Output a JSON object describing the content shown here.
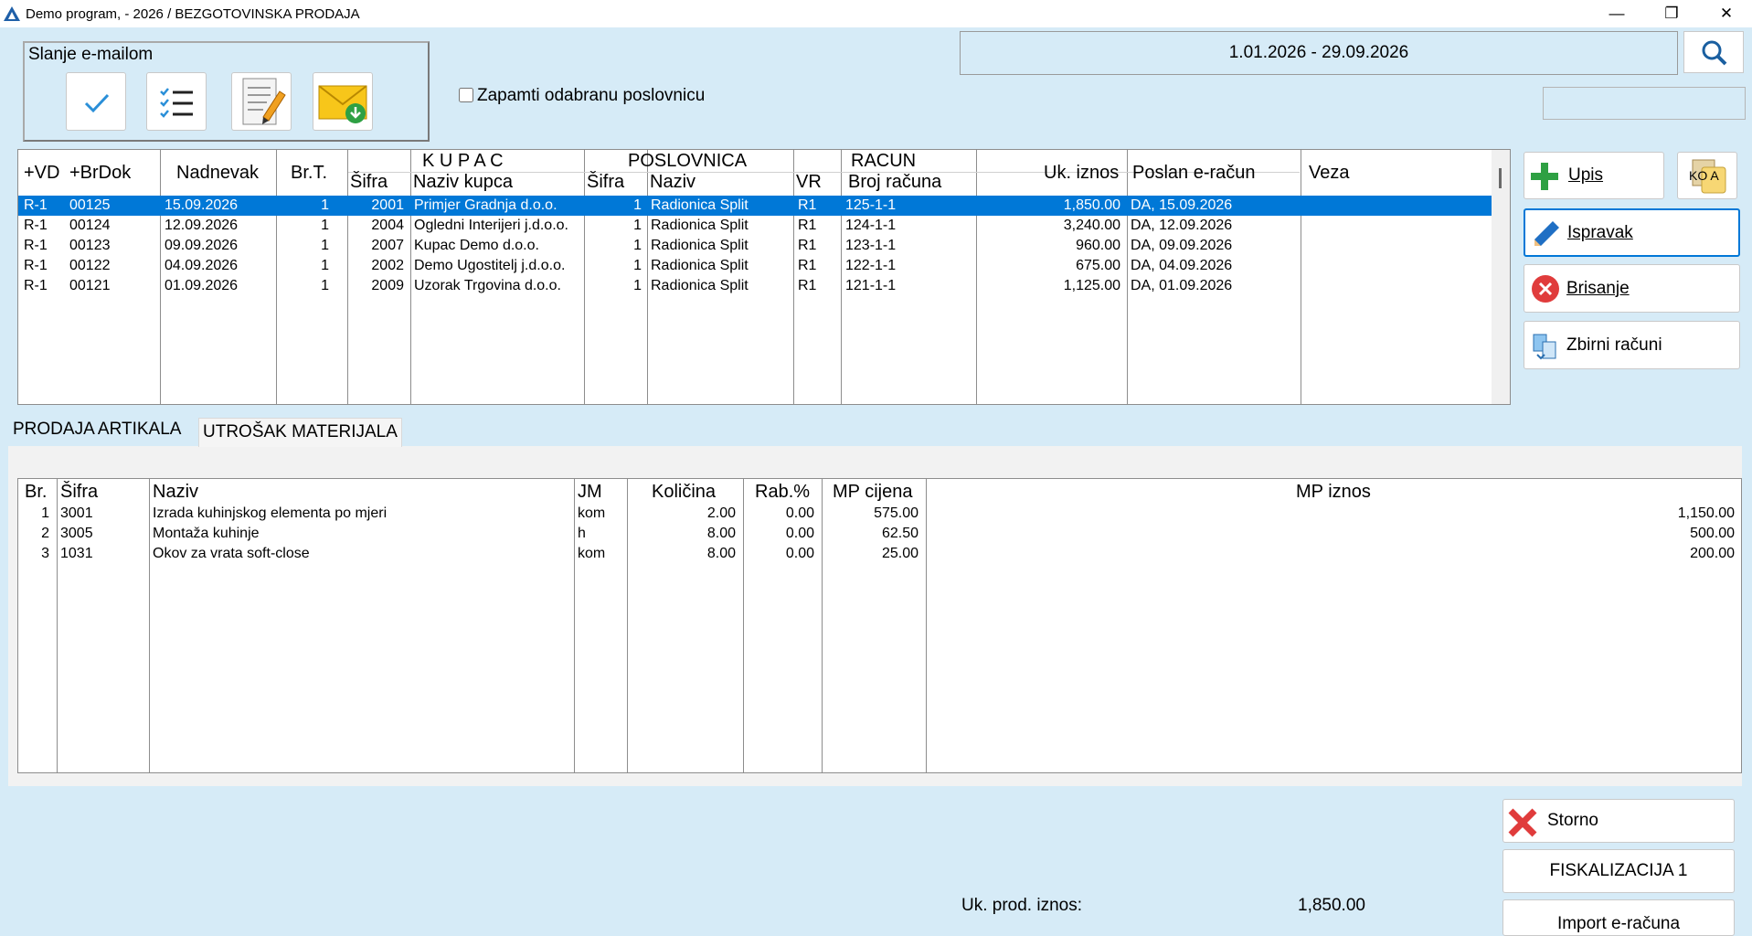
{
  "window": {
    "title": "Demo program, - 2026 / BEZGOTOVINSKA PRODAJA",
    "min_glyph": "—",
    "restore_glyph": "❐",
    "close_glyph": "✕"
  },
  "email_group": {
    "caption": "Slanje e-mailom",
    "buttons": [
      "check-icon",
      "checklist-icon",
      "document-edit-icon",
      "envelope-download-icon"
    ]
  },
  "remember_checkbox": {
    "label": "Zapamti odabranu poslovnicu",
    "checked": false
  },
  "date_range": "1.01.2026 - 29.09.2026",
  "main_grid": {
    "headers": {
      "vd": "+VD",
      "brdok": "+BrDok",
      "nadnevak": "Nadnevak",
      "brt": "Br.T.",
      "kupac_group": "K U P A C",
      "kupac_sifra": "Šifra",
      "kupac_naziv": "Naziv kupca",
      "posl_group": "POSLOVNICA",
      "posl_sifra": "Šifra",
      "posl_naziv": "Naziv",
      "racun_group": "RACUN",
      "racun_vr": "VR",
      "racun_broj": "Broj računa",
      "iznos": "Uk. iznos",
      "poslan": "Poslan e-račun",
      "veza": "Veza"
    },
    "rows": [
      {
        "vd": "R-1",
        "brdok": "00125",
        "nadnevak": "15.09.2026",
        "brt": "1",
        "kupac_sifra": "2001",
        "kupac_naziv": "Primjer Gradnja d.o.o.",
        "posl_sifra": "1",
        "posl_naziv": "Radionica Split",
        "vr": "R1",
        "broj": "125-1-1",
        "iznos": "1,850.00",
        "poslan": "DA, 15.09.2026",
        "veza": ""
      },
      {
        "vd": "R-1",
        "brdok": "00124",
        "nadnevak": "12.09.2026",
        "brt": "1",
        "kupac_sifra": "2004",
        "kupac_naziv": "Ogledni Interijeri j.d.o.o.",
        "posl_sifra": "1",
        "posl_naziv": "Radionica Split",
        "vr": "R1",
        "broj": "124-1-1",
        "iznos": "3,240.00",
        "poslan": "DA, 12.09.2026",
        "veza": ""
      },
      {
        "vd": "R-1",
        "brdok": "00123",
        "nadnevak": "09.09.2026",
        "brt": "1",
        "kupac_sifra": "2007",
        "kupac_naziv": "Kupac Demo d.o.o.",
        "posl_sifra": "1",
        "posl_naziv": "Radionica Split",
        "vr": "R1",
        "broj": "123-1-1",
        "iznos": "960.00",
        "poslan": "DA, 09.09.2026",
        "veza": ""
      },
      {
        "vd": "R-1",
        "brdok": "00122",
        "nadnevak": "04.09.2026",
        "brt": "1",
        "kupac_sifra": "2002",
        "kupac_naziv": "Demo Ugostitelj j.d.o.o.",
        "posl_sifra": "1",
        "posl_naziv": "Radionica Split",
        "vr": "R1",
        "broj": "122-1-1",
        "iznos": "675.00",
        "poslan": "DA, 04.09.2026",
        "veza": ""
      },
      {
        "vd": "R-1",
        "brdok": "00121",
        "nadnevak": "01.09.2026",
        "brt": "1",
        "kupac_sifra": "2009",
        "kupac_naziv": "Uzorak Trgovina d.o.o.",
        "posl_sifra": "1",
        "posl_naziv": "Radionica Split",
        "vr": "R1",
        "broj": "121-1-1",
        "iznos": "1,125.00",
        "poslan": "DA, 01.09.2026",
        "veza": ""
      }
    ],
    "selected_row": 0
  },
  "side_buttons": {
    "upis": "Upis",
    "kopija_partial": "KO A",
    "ispravak": "Ispravak",
    "brisanje": "Brisanje",
    "zbirni": "Zbirni računi"
  },
  "tabs": [
    {
      "label": "PRODAJA ARTIKALA",
      "active": true
    },
    {
      "label": "UTROŠAK MATERIJALA",
      "active": false
    }
  ],
  "items_grid": {
    "headers": {
      "br": "Br.",
      "sifra": "Šifra",
      "naziv": "Naziv",
      "jm": "JM",
      "kolicina": "Količina",
      "rabat": "Rab.%",
      "cijena": "MP cijena",
      "iznos": "MP iznos"
    },
    "rows": [
      {
        "br": "1",
        "sifra": "3001",
        "naziv": "Izrada kuhinjskog elementa po mjeri",
        "jm": "kom",
        "kolicina": "2.00",
        "rabat": "0.00",
        "cijena": "575.00",
        "iznos": "1,150.00"
      },
      {
        "br": "2",
        "sifra": "3005",
        "naziv": "Montaža kuhinje",
        "jm": "h",
        "kolicina": "8.00",
        "rabat": "0.00",
        "cijena": "62.50",
        "iznos": "500.00"
      },
      {
        "br": "3",
        "sifra": "1031",
        "naziv": "Okov za vrata soft-close",
        "jm": "kom",
        "kolicina": "8.00",
        "rabat": "0.00",
        "cijena": "25.00",
        "iznos": "200.00"
      }
    ]
  },
  "bottom": {
    "storno": "Storno",
    "fiskalizacija": "FISKALIZACIJA 1",
    "import": "Import e-računa",
    "total_label": "Uk. prod. iznos:",
    "total_value": "1,850.00"
  },
  "colors": {
    "background": "#d6ebf7",
    "selection": "#0078d7",
    "plus_green": "#2ea043",
    "delete_red": "#e03c3c"
  }
}
